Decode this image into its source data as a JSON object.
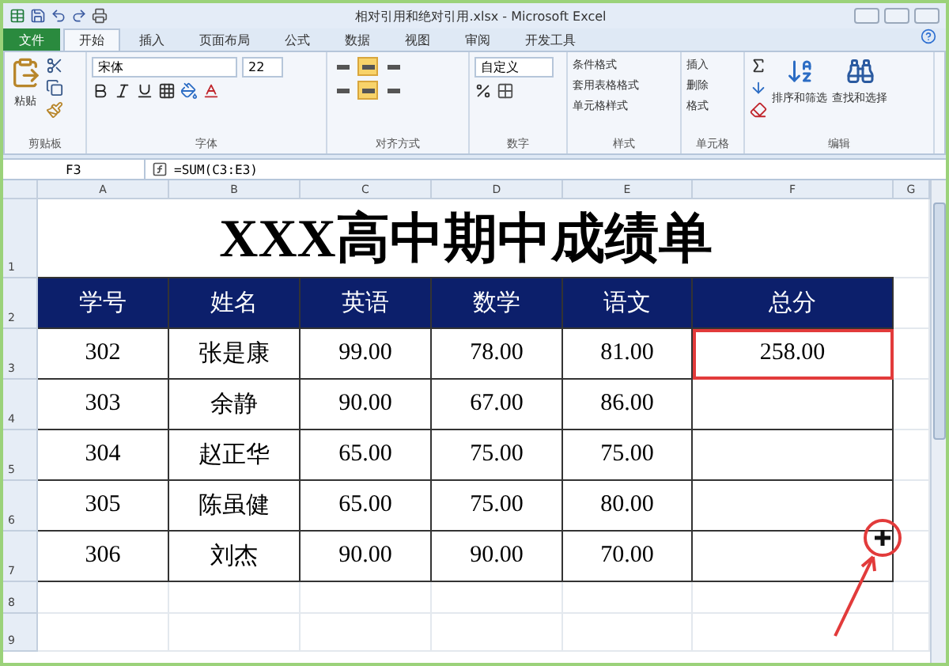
{
  "window": {
    "title": "相对引用和绝对引用.xlsx - Microsoft Excel"
  },
  "tabs": [
    {
      "label": "文件",
      "kind": "file",
      "selected": false
    },
    {
      "label": "开始",
      "kind": "tab",
      "selected": true
    },
    {
      "label": "插入",
      "kind": "tab",
      "selected": false
    },
    {
      "label": "页面布局",
      "kind": "tab",
      "selected": false
    },
    {
      "label": "公式",
      "kind": "tab",
      "selected": false
    },
    {
      "label": "数据",
      "kind": "tab",
      "selected": false
    },
    {
      "label": "视图",
      "kind": "tab",
      "selected": false
    },
    {
      "label": "审阅",
      "kind": "tab",
      "selected": false
    },
    {
      "label": "开发工具",
      "kind": "tab",
      "selected": false
    }
  ],
  "ribbon": {
    "clipboard": {
      "paste": "粘贴",
      "label": "剪贴板"
    },
    "font": {
      "name": "宋体",
      "size": "22",
      "label": "字体"
    },
    "alignment": {
      "label": "对齐方式",
      "vertical": [
        {
          "selected": false
        },
        {
          "selected": true
        },
        {
          "selected": false
        }
      ],
      "horizontal": [
        {
          "selected": false
        },
        {
          "selected": true
        },
        {
          "selected": false
        }
      ]
    },
    "number": {
      "format": "自定义",
      "label": "数字"
    },
    "styles": {
      "items": [
        "条件格式",
        "套用表格格式",
        "单元格样式"
      ],
      "label": "样式"
    },
    "cells": {
      "items": [
        "插入",
        "删除",
        "格式"
      ],
      "label": "单元格"
    },
    "editing": {
      "items": [
        "排序和筛选",
        "查找和选择"
      ],
      "label": "编辑"
    }
  },
  "formula_bar": {
    "name_box": "F3",
    "formula": "=SUM(C3:E3)"
  },
  "sheet": {
    "columns": [
      "A",
      "B",
      "C",
      "D",
      "E",
      "F",
      "G"
    ],
    "row_numbers": [
      "1",
      "2",
      "3",
      "4",
      "5",
      "6",
      "7",
      "8",
      "9"
    ],
    "title": "XXX高中期中成绩单",
    "headers": [
      "学号",
      "姓名",
      "英语",
      "数学",
      "语文",
      "总分"
    ],
    "rows": [
      {
        "cells": [
          {
            "text": "302",
            "selected": false
          },
          {
            "text": "张是康",
            "selected": false
          },
          {
            "text": "99.00",
            "selected": false
          },
          {
            "text": "78.00",
            "selected": false
          },
          {
            "text": "81.00",
            "selected": false
          },
          {
            "text": "258.00",
            "selected": true
          }
        ]
      },
      {
        "cells": [
          {
            "text": "303",
            "selected": false
          },
          {
            "text": "余静",
            "selected": false
          },
          {
            "text": "90.00",
            "selected": false
          },
          {
            "text": "67.00",
            "selected": false
          },
          {
            "text": "86.00",
            "selected": false
          },
          {
            "selected": false
          }
        ]
      },
      {
        "cells": [
          {
            "text": "304",
            "selected": false
          },
          {
            "text": "赵正华",
            "selected": false
          },
          {
            "text": "65.00",
            "selected": false
          },
          {
            "text": "75.00",
            "selected": false
          },
          {
            "text": "75.00",
            "selected": false
          },
          {
            "selected": false
          }
        ]
      },
      {
        "cells": [
          {
            "text": "305",
            "selected": false
          },
          {
            "text": "陈虽健",
            "selected": false
          },
          {
            "text": "65.00",
            "selected": false
          },
          {
            "text": "75.00",
            "selected": false
          },
          {
            "text": "80.00",
            "selected": false
          },
          {
            "selected": false
          }
        ]
      },
      {
        "cells": [
          {
            "text": "306",
            "selected": false
          },
          {
            "text": "刘杰",
            "selected": false
          },
          {
            "text": "90.00",
            "selected": false
          },
          {
            "text": "90.00",
            "selected": false
          },
          {
            "text": "70.00",
            "selected": false
          },
          {
            "selected": false
          }
        ]
      }
    ]
  }
}
